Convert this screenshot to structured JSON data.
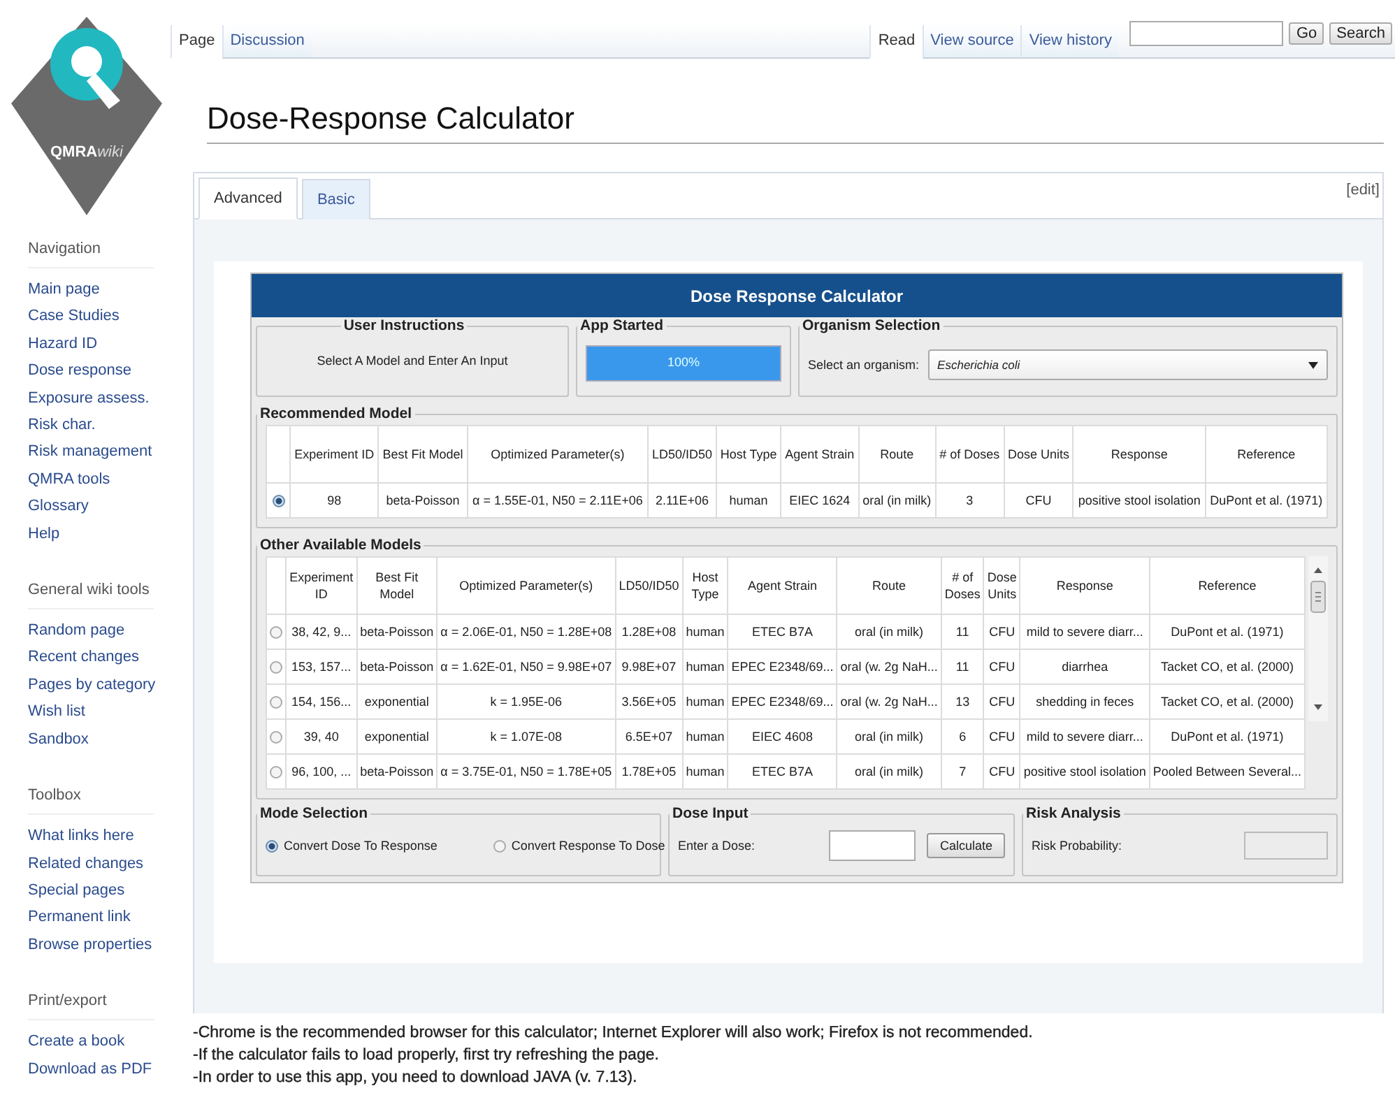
{
  "sidebar": {
    "logo_text": "QMRA",
    "logo_suffix": "wiki",
    "sections": [
      {
        "title": "Navigation",
        "items": [
          "Main page",
          "Case Studies",
          "Hazard ID",
          "Dose response",
          "Exposure assess.",
          "Risk char.",
          "Risk management",
          "QMRA tools",
          "Glossary",
          "Help"
        ]
      },
      {
        "title": "General wiki tools",
        "items": [
          "Random page",
          "Recent changes",
          "Pages by category",
          "Wish list",
          "Sandbox"
        ]
      },
      {
        "title": "Toolbox",
        "items": [
          "What links here",
          "Related changes",
          "Special pages",
          "Permanent link",
          "Browse properties"
        ]
      },
      {
        "title": "Print/export",
        "items": [
          "Create a book",
          "Download as PDF"
        ]
      }
    ]
  },
  "page_tabs": [
    {
      "label": "Page",
      "selected": true
    },
    {
      "label": "Discussion",
      "selected": false
    }
  ],
  "view_tabs": [
    {
      "label": "Read",
      "selected": true
    },
    {
      "label": "View source",
      "selected": false
    },
    {
      "label": "View history",
      "selected": false
    }
  ],
  "search": {
    "buttons": [
      "Go",
      "Search"
    ]
  },
  "title": "Dose-Response Calculator",
  "content_tabs": [
    {
      "label": "Advanced",
      "selected": true
    },
    {
      "label": "Basic",
      "selected": false
    }
  ],
  "edit_link": "[edit]",
  "applet": {
    "title": "Dose Response Calculator",
    "user_instructions": {
      "legend": "User Instructions",
      "text": "Select A Model and Enter An Input"
    },
    "app_started": {
      "legend": "App Started",
      "level": 1,
      "reading": "100%"
    },
    "organism": {
      "legend": "Organism Selection",
      "label": "Select an organism:",
      "value": "Escherichia coli"
    },
    "recommended": {
      "legend": "Recommended Model",
      "columns": [
        "Experiment ID",
        "Best Fit Model",
        "Optimized Parameter(s)",
        "LD50/ID50",
        "Host Type",
        "Agent Strain",
        "Route",
        "# of Doses",
        "Dose Units",
        "Response",
        "Reference"
      ],
      "rows": [
        {
          "selected": true,
          "cells": [
            "98",
            "beta-Poisson",
            "α = 1.55E-01, N50 = 2.11E+06",
            "2.11E+06",
            "human",
            "EIEC 1624",
            "oral (in milk)",
            "3",
            "CFU",
            "positive stool isolation",
            "DuPont et al. (1971)"
          ]
        }
      ]
    },
    "other": {
      "legend": "Other Available Models",
      "columns": [
        "Experiment ID",
        "Best Fit Model",
        "Optimized Parameter(s)",
        "LD50/ID50",
        "Host Type",
        "Agent Strain",
        "Route",
        "# of Doses",
        "Dose Units",
        "Response",
        "Reference"
      ],
      "rows": [
        {
          "selected": false,
          "cells": [
            "38, 42, 9...",
            "beta-Poisson",
            "α = 2.06E-01, N50 = 1.28E+08",
            "1.28E+08",
            "human",
            "ETEC B7A",
            "oral (in milk)",
            "11",
            "CFU",
            "mild to severe diarr...",
            "DuPont et al. (1971)"
          ]
        },
        {
          "selected": false,
          "cells": [
            "153, 157...",
            "beta-Poisson",
            "α = 1.62E-01, N50 = 9.98E+07",
            "9.98E+07",
            "human",
            "EPEC E2348/69...",
            "oral (w. 2g NaH...",
            "11",
            "CFU",
            "diarrhea",
            "Tacket CO, et al. (2000)"
          ]
        },
        {
          "selected": false,
          "cells": [
            "154, 156...",
            "exponential",
            "k = 1.95E-06",
            "3.56E+05",
            "human",
            "EPEC E2348/69...",
            "oral (w. 2g NaH...",
            "13",
            "CFU",
            "shedding in feces",
            "Tacket CO, et al. (2000)"
          ]
        },
        {
          "selected": false,
          "cells": [
            "39, 40",
            "exponential",
            "k = 1.07E-08",
            "6.5E+07",
            "human",
            "EIEC 4608",
            "oral (in milk)",
            "6",
            "CFU",
            "mild to severe diarr...",
            "DuPont et al. (1971)"
          ]
        },
        {
          "selected": false,
          "cells": [
            "96, 100, ...",
            "beta-Poisson",
            "α = 3.75E-01, N50 = 1.78E+05",
            "1.78E+05",
            "human",
            "ETEC B7A",
            "oral (in milk)",
            "7",
            "CFU",
            "positive stool isolation",
            "Pooled Between Several..."
          ]
        }
      ]
    },
    "mode": {
      "legend": "Mode Selection",
      "options": [
        {
          "label": "Convert Dose To Response",
          "selected": true
        },
        {
          "label": "Convert Response To Dose",
          "selected": false
        }
      ]
    },
    "dose_input": {
      "legend": "Dose Input",
      "label": "Enter a Dose:",
      "button": "Calculate"
    },
    "risk": {
      "legend": "Risk Analysis",
      "label": "Risk Probability:"
    }
  },
  "notes": [
    "-Chrome is the recommended browser for this calculator; Internet Explorer will also work; Firefox is not recommended.",
    "-If the calculator fails to load properly, first try refreshing the page.",
    "-In order to use this app, you need to download JAVA (v. 7.13)."
  ]
}
